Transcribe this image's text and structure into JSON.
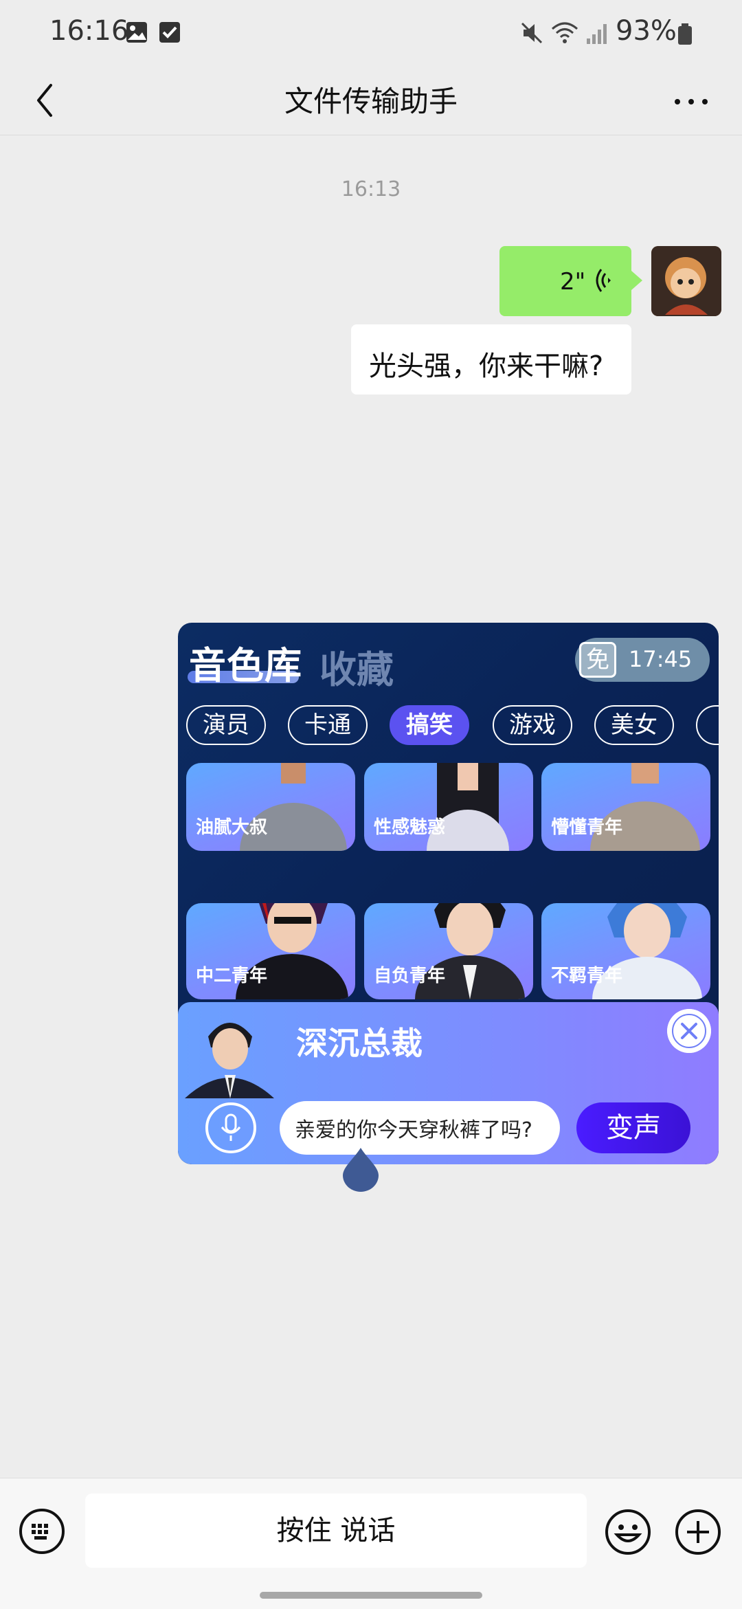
{
  "status_bar": {
    "time": "16:16",
    "battery": "93%"
  },
  "header": {
    "title": "文件传输助手"
  },
  "chat": {
    "timestamp": "16:13",
    "voice_message": {
      "duration": "2\""
    },
    "text_message": "光头强，你来干嘛?"
  },
  "voice_panel": {
    "tabs": {
      "library": "音色库",
      "favorites": "收藏"
    },
    "free_label": "免",
    "timer": "17:45",
    "categories": [
      "演员",
      "卡通",
      "搞笑",
      "游戏",
      "美女"
    ],
    "active_category": "搞笑",
    "voices": [
      {
        "name": "油腻大叔"
      },
      {
        "name": "性感魅惑"
      },
      {
        "name": "懵懂青年"
      },
      {
        "name": "中二青年"
      },
      {
        "name": "自负青年"
      },
      {
        "name": "不羁青年"
      }
    ],
    "selected_voice": "深沉总裁",
    "input_text": "亲爱的你今天穿秋裤了吗?",
    "change_button": "变声"
  },
  "input_bar": {
    "hold_to_talk": "按住 说话"
  },
  "colors": {
    "wechat_green": "#95ec69",
    "panel_navy": "#0a2356",
    "accent_purple": "#5b52f0"
  }
}
